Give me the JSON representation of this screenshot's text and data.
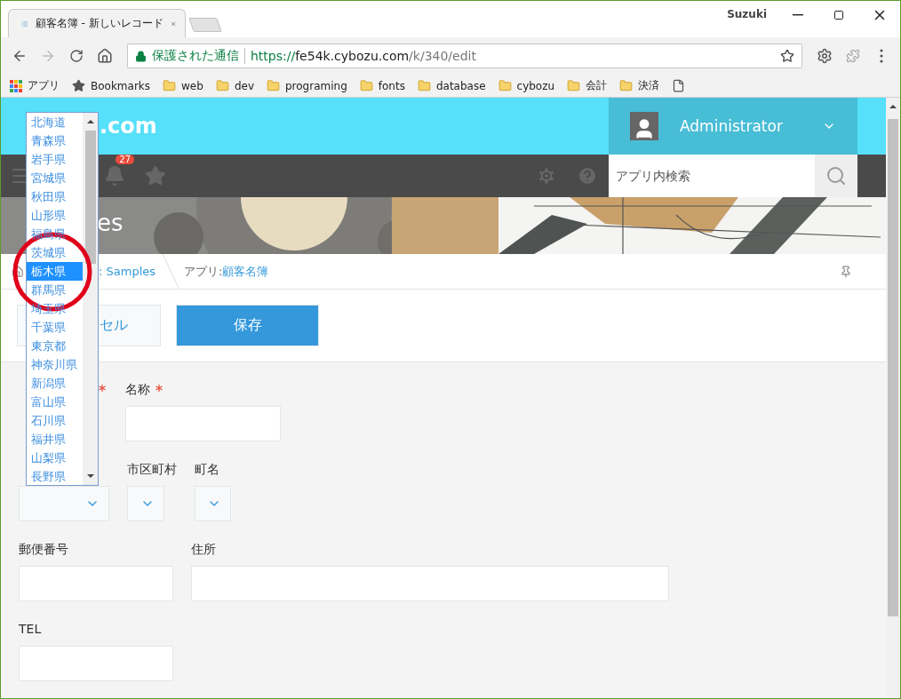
{
  "browser": {
    "tab": {
      "title": "顧客名簿 - 新しいレコード"
    },
    "profile": "Suzuki",
    "address": {
      "security": "保護された通信",
      "scheme": "https://",
      "host": "fe54k.cybozu.com",
      "path": "/k/340/edit"
    },
    "bookmarks": [
      {
        "kind": "apps",
        "label": "アプリ"
      },
      {
        "kind": "star",
        "label": "Bookmarks"
      },
      {
        "kind": "folder",
        "label": "web"
      },
      {
        "kind": "folder",
        "label": "dev"
      },
      {
        "kind": "folder",
        "label": "programing"
      },
      {
        "kind": "folder",
        "label": "fonts"
      },
      {
        "kind": "folder",
        "label": "database"
      },
      {
        "kind": "folder",
        "label": "cybozu"
      },
      {
        "kind": "folder",
        "label": "会計"
      },
      {
        "kind": "folder",
        "label": "決済"
      },
      {
        "kind": "page"
      }
    ]
  },
  "header": {
    "logo": ".com",
    "user": "Administrator",
    "notifications": "27",
    "search": {
      "placeholder": "アプリ内検索"
    },
    "space_title": "es"
  },
  "breadcrumb": [
    {
      "label": ": Samples"
    },
    {
      "prefix": "アプリ:",
      "label": "顧客名簿"
    }
  ],
  "actions": {
    "cancel": "セル",
    "save": "保存"
  },
  "form": {
    "groups": [
      {
        "fields": [
          {
            "required": true,
            "kind": "hidden"
          },
          {
            "label": "名称",
            "required": true,
            "kind": "text"
          }
        ]
      },
      {
        "fields": [
          {
            "kind": "select"
          },
          {
            "label": "市区町村",
            "kind": "select"
          },
          {
            "label": "町名",
            "kind": "select"
          }
        ]
      },
      {
        "fields": [
          {
            "label": "郵便番号",
            "kind": "text"
          },
          {
            "label": "住所",
            "kind": "text"
          }
        ]
      },
      {
        "fields": [
          {
            "label": "TEL",
            "kind": "text"
          }
        ]
      }
    ]
  },
  "dropdown": {
    "options": [
      {
        "label": "北海道",
        "selected": false
      },
      {
        "label": "青森県",
        "selected": false
      },
      {
        "label": "岩手県",
        "selected": false
      },
      {
        "label": "宮城県",
        "selected": false
      },
      {
        "label": "秋田県",
        "selected": false
      },
      {
        "label": "山形県",
        "selected": false
      },
      {
        "label": "福島県",
        "selected": false
      },
      {
        "label": "茨城県",
        "selected": false
      },
      {
        "label": "栃木県",
        "selected": true
      },
      {
        "label": "群馬県",
        "selected": false
      },
      {
        "label": "埼玉県",
        "selected": false
      },
      {
        "label": "千葉県",
        "selected": false
      },
      {
        "label": "東京都",
        "selected": false
      },
      {
        "label": "神奈川県",
        "selected": false
      },
      {
        "label": "新潟県",
        "selected": false
      },
      {
        "label": "富山県",
        "selected": false
      },
      {
        "label": "石川県",
        "selected": false
      },
      {
        "label": "福井県",
        "selected": false
      },
      {
        "label": "山梨県",
        "selected": false
      },
      {
        "label": "長野県",
        "selected": false
      }
    ]
  }
}
